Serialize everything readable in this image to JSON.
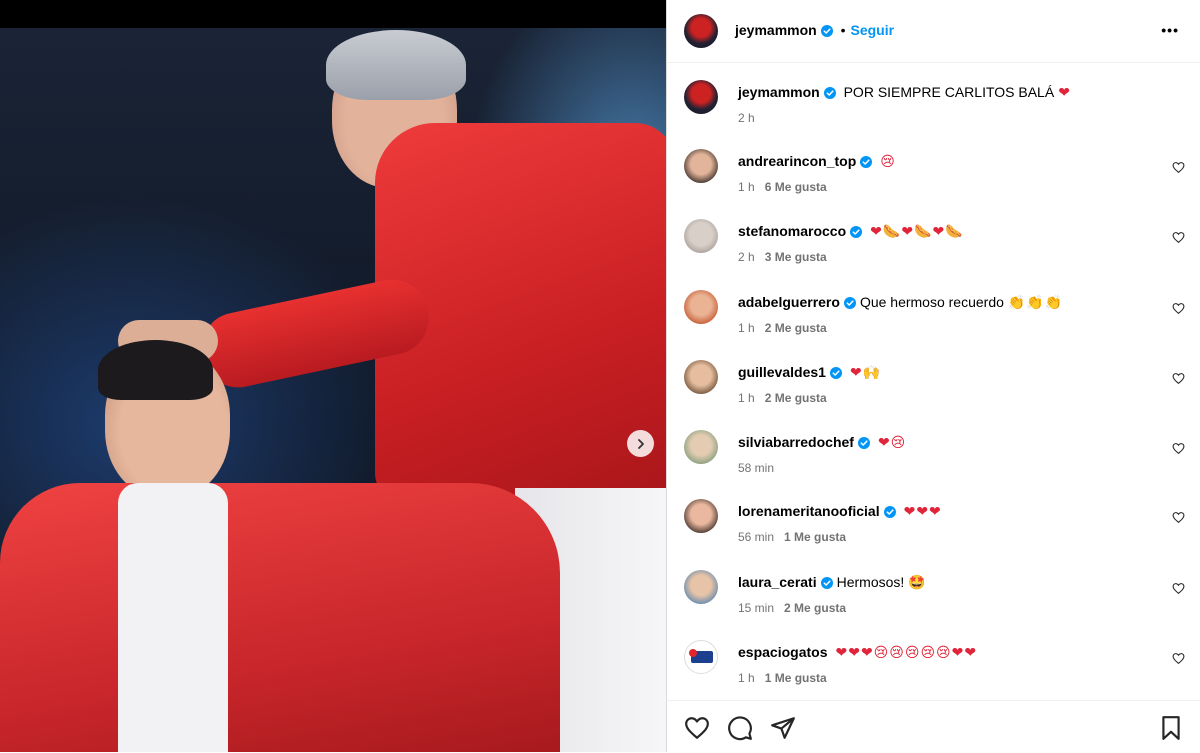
{
  "post": {
    "author": "jeymammon",
    "follow_label": "Seguir",
    "more_label": "•••",
    "separator": "•"
  },
  "caption": {
    "username": "jeymammon",
    "text": "POR SIEMPRE CARLITOS BALÁ",
    "emoji": "❤",
    "time": "2 h"
  },
  "comments": [
    {
      "username": "andrearincon_top",
      "text": "",
      "emoji": "😢",
      "time": "1 h",
      "likes": "6 Me gusta"
    },
    {
      "username": "stefanomarocco",
      "text": "",
      "emoji": "❤🌭❤🌭❤🌭",
      "time": "2 h",
      "likes": "3 Me gusta"
    },
    {
      "username": "adabelguerrero",
      "text": "Que hermoso recuerdo",
      "emoji": "👏👏👏",
      "time": "1 h",
      "likes": "2 Me gusta"
    },
    {
      "username": "guillevaldes1",
      "text": "",
      "emoji": "❤🙌",
      "time": "1 h",
      "likes": "2 Me gusta"
    },
    {
      "username": "silviabarredochef",
      "text": "",
      "emoji": "❤😢",
      "time": "58 min",
      "likes": ""
    },
    {
      "username": "lorenameritanooficial",
      "text": "",
      "emoji": "❤❤❤",
      "time": "56 min",
      "likes": "1 Me gusta"
    },
    {
      "username": "laura_cerati",
      "text": "Hermosos!",
      "emoji": "🤩",
      "time": "15 min",
      "likes": "2 Me gusta"
    },
    {
      "username": "espaciogatos",
      "text": "",
      "emoji": "❤❤❤😢😢😢😢😢❤❤",
      "time": "1 h",
      "likes": "1 Me gusta"
    }
  ],
  "icons": {
    "like": "heart-icon",
    "comment": "comment-icon",
    "share": "share-icon",
    "save": "bookmark-icon",
    "next": "chevron-right-icon",
    "verified": "verified-badge-icon"
  },
  "colors": {
    "link_blue": "#0095f6",
    "verified_blue": "#0095f6",
    "jacket_red": "#d8262a",
    "muted": "#737373"
  }
}
